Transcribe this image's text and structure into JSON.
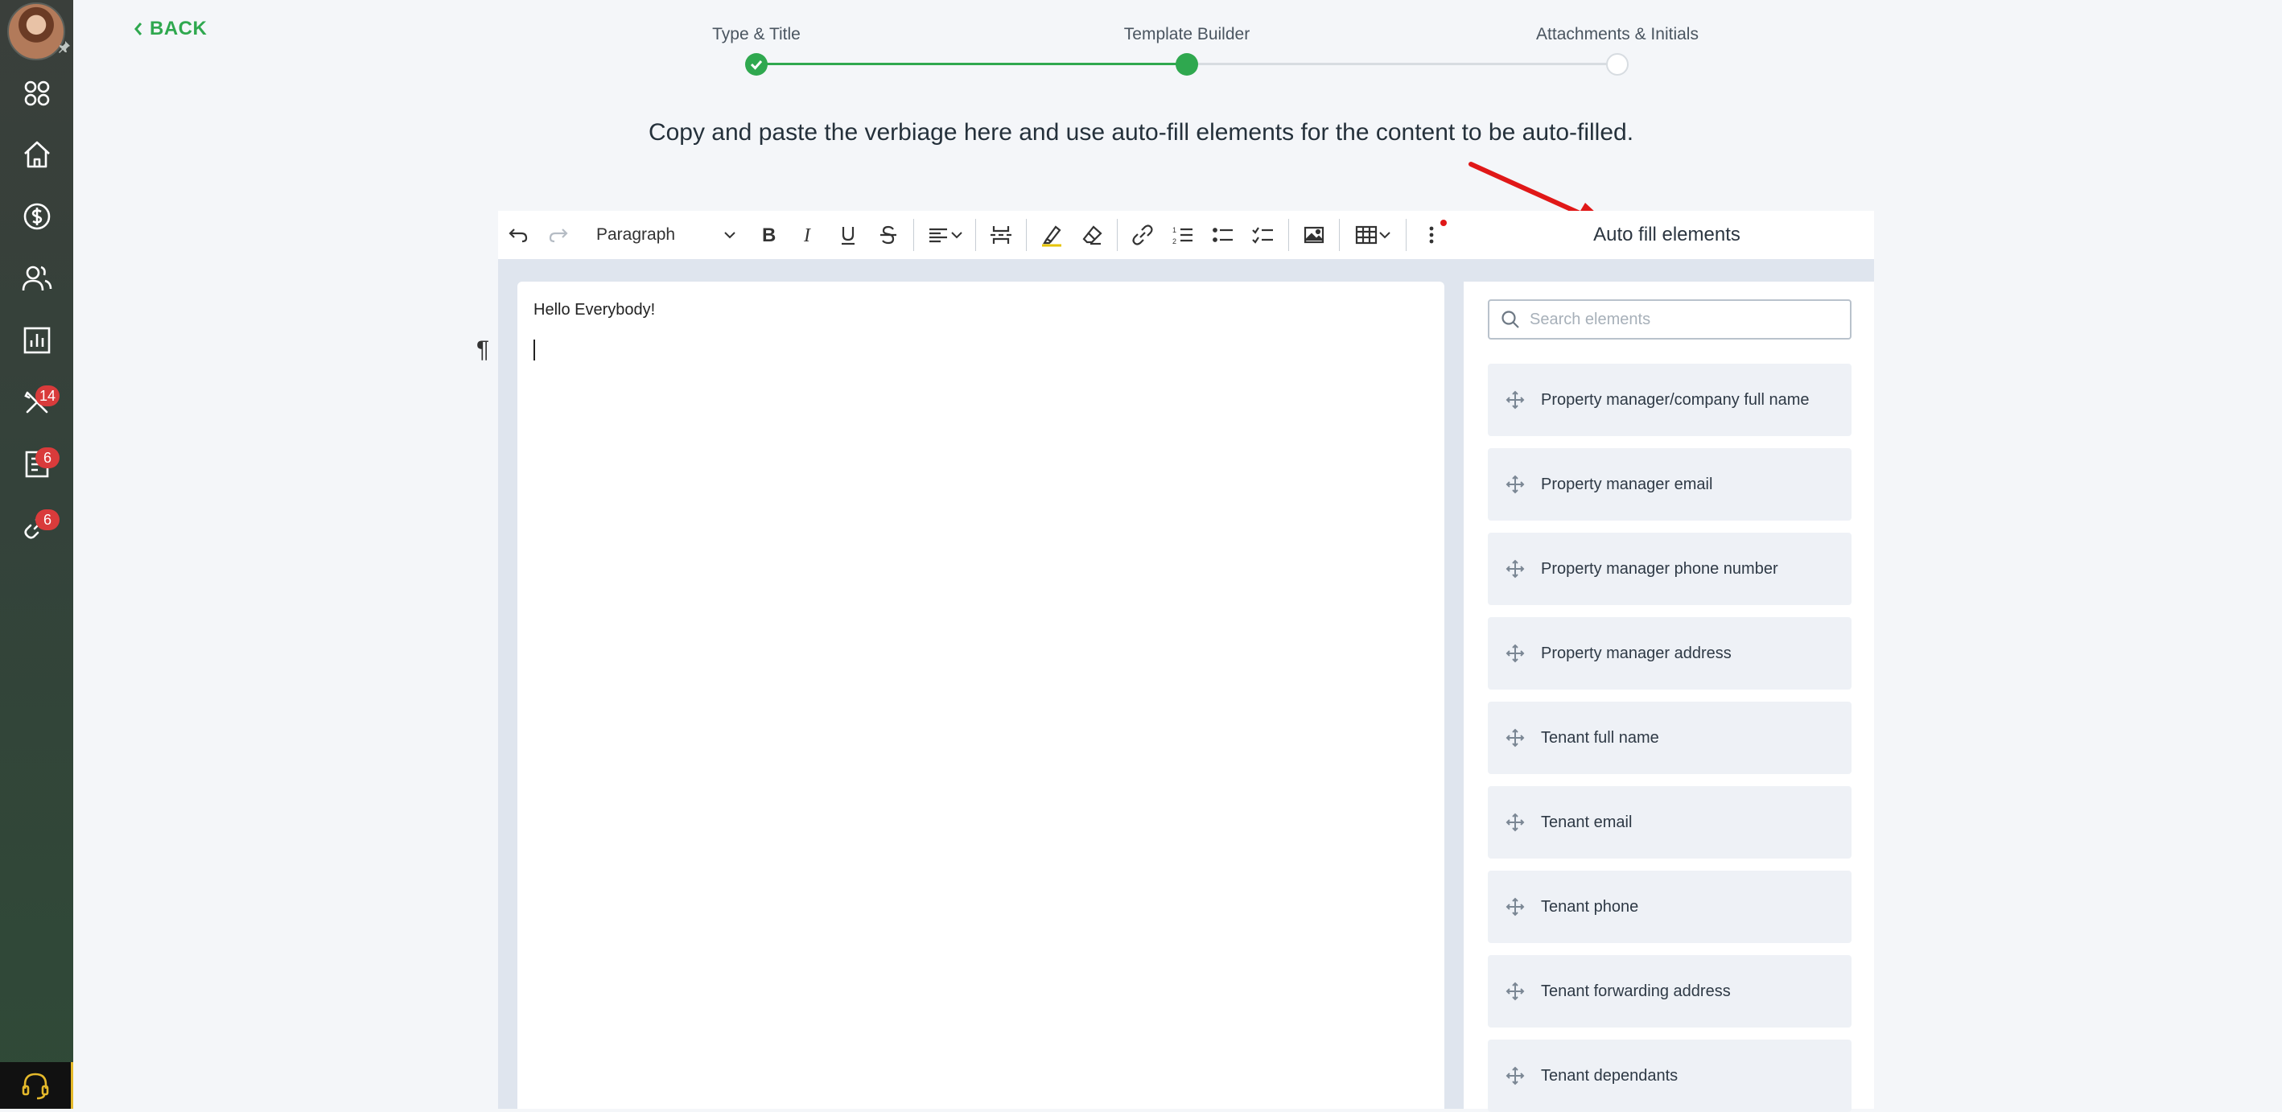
{
  "sidebar": {
    "items": [
      {
        "icon": "apps-grid-icon",
        "badge": ""
      },
      {
        "icon": "home-icon",
        "badge": ""
      },
      {
        "icon": "dollar-icon",
        "badge": ""
      },
      {
        "icon": "users-icon",
        "badge": ""
      },
      {
        "icon": "chart-icon",
        "badge": ""
      },
      {
        "icon": "tools-icon",
        "badge": "14"
      },
      {
        "icon": "document-icon",
        "badge": "6"
      },
      {
        "icon": "link-icon",
        "badge": "6"
      }
    ],
    "support_icon": "headset-icon"
  },
  "header": {
    "back_label": "BACK"
  },
  "stepper": {
    "steps": [
      {
        "label": "Type & Title",
        "state": "done"
      },
      {
        "label": "Template Builder",
        "state": "current"
      },
      {
        "label": "Attachments & Initials",
        "state": "pending"
      }
    ],
    "colors": {
      "active": "#2fa84f",
      "inactive": "#d7dce1"
    }
  },
  "instruction": "Copy and paste the verbiage here and use auto-fill elements for the content to be auto-filled.",
  "toolbar": {
    "paragraph_style": "Paragraph"
  },
  "editor": {
    "content_line": "Hello Everybody!",
    "pilcrow": "¶"
  },
  "autofill": {
    "title": "Auto fill elements",
    "search_placeholder": "Search elements",
    "items": [
      "Property manager/company full name",
      "Property manager email",
      "Property manager phone number",
      "Property manager address",
      "Tenant full name",
      "Tenant email",
      "Tenant phone",
      "Tenant forwarding address",
      "Tenant dependants"
    ]
  },
  "colors": {
    "brand_green": "#2fa84f",
    "badge_red": "#d93b3b",
    "arrow_red": "#e01818"
  }
}
